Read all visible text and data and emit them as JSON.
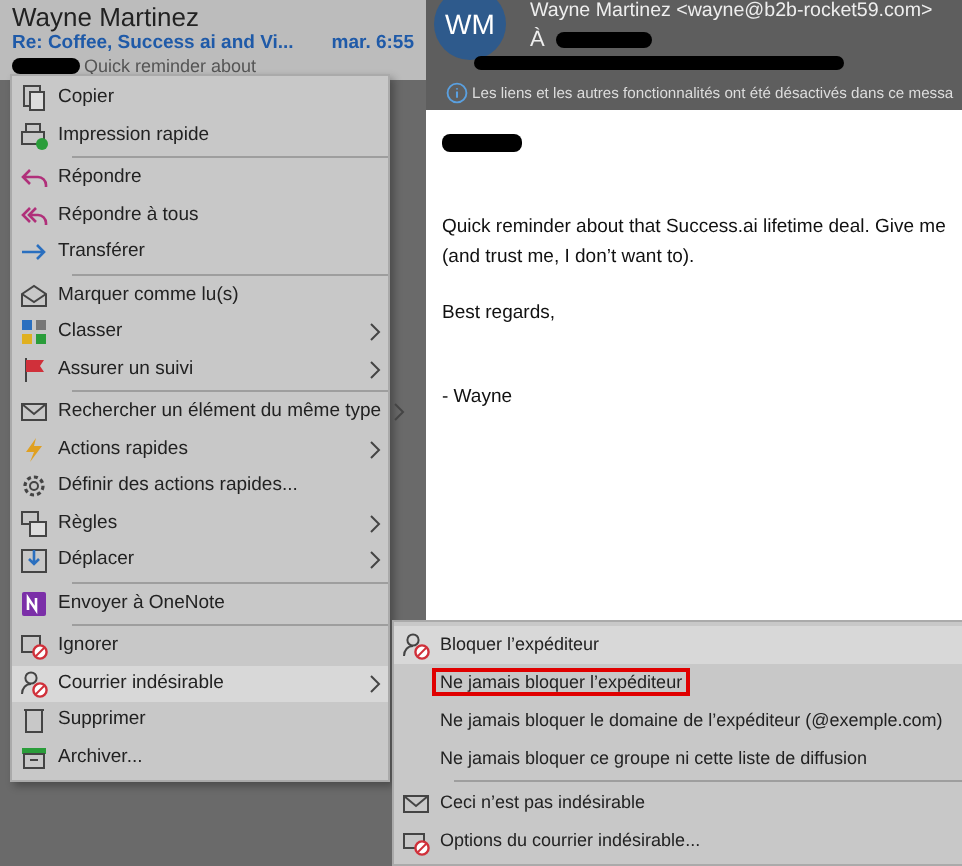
{
  "message_list": {
    "sender": "Wayne Martinez",
    "subject": "Re: Coffee, Success ai and Vi...",
    "date": "mar. 6:55",
    "preview": "Quick reminder about"
  },
  "reading_pane": {
    "avatar_initials": "WM",
    "from": "Wayne Martinez <wayne@b2b-rocket59.com>",
    "to_label": "À",
    "info_bar": "Les liens et les autres fonctionnalités ont été désactivés dans ce messa",
    "body": [
      "Quick reminder about that Success.ai lifetime deal. Give me",
      "(and trust me, I don’t want to).",
      "Best regards,",
      "- Wayne"
    ]
  },
  "context_menu": [
    {
      "kind": "item",
      "label": "Copier",
      "submenu": false,
      "hovered": false
    },
    {
      "kind": "item",
      "label": "Impression rapide",
      "submenu": false,
      "hovered": false
    },
    {
      "kind": "separator"
    },
    {
      "kind": "item",
      "label": "Répondre",
      "submenu": false,
      "hovered": false
    },
    {
      "kind": "item",
      "label": "Répondre à tous",
      "submenu": false,
      "hovered": false
    },
    {
      "kind": "item",
      "label": "Transférer",
      "submenu": false,
      "hovered": false
    },
    {
      "kind": "separator"
    },
    {
      "kind": "item",
      "label": "Marquer comme lu(s)",
      "submenu": false,
      "hovered": false
    },
    {
      "kind": "item",
      "label": "Classer",
      "submenu": true,
      "hovered": false
    },
    {
      "kind": "item",
      "label": "Assurer un suivi",
      "submenu": true,
      "hovered": false
    },
    {
      "kind": "separator"
    },
    {
      "kind": "item",
      "label": "Rechercher un élément du même type",
      "submenu": true,
      "hovered": false
    },
    {
      "kind": "item",
      "label": "Actions rapides",
      "submenu": true,
      "hovered": false
    },
    {
      "kind": "item",
      "label": "Définir des actions rapides...",
      "submenu": false,
      "hovered": false
    },
    {
      "kind": "item",
      "label": "Règles",
      "submenu": true,
      "hovered": false
    },
    {
      "kind": "item",
      "label": "Déplacer",
      "submenu": true,
      "hovered": false
    },
    {
      "kind": "separator"
    },
    {
      "kind": "item",
      "label": "Envoyer à OneNote",
      "submenu": false,
      "hovered": false
    },
    {
      "kind": "separator"
    },
    {
      "kind": "item",
      "label": "Ignorer",
      "submenu": false,
      "hovered": false
    },
    {
      "kind": "item",
      "label": "Courrier indésirable",
      "submenu": true,
      "hovered": true
    },
    {
      "kind": "item",
      "label": "Supprimer",
      "submenu": false,
      "hovered": false
    },
    {
      "kind": "item",
      "label": "Archiver...",
      "submenu": false,
      "hovered": false
    }
  ],
  "junk_submenu": [
    {
      "kind": "item",
      "label": "Bloquer l’expéditeur",
      "hovered": true,
      "outlined": false
    },
    {
      "kind": "item",
      "label": "Ne jamais bloquer l’expéditeur",
      "hovered": false,
      "outlined": true
    },
    {
      "kind": "item",
      "label": "Ne jamais bloquer le domaine de l’expéditeur (@exemple.com)",
      "hovered": false,
      "outlined": false
    },
    {
      "kind": "item",
      "label": "Ne jamais bloquer ce groupe ni cette liste de diffusion",
      "hovered": false,
      "outlined": false
    },
    {
      "kind": "separator"
    },
    {
      "kind": "item",
      "label": "Ceci n’est pas indésirable",
      "hovered": false,
      "outlined": false
    },
    {
      "kind": "item",
      "label": "Options du courrier indésirable...",
      "hovered": false,
      "outlined": false
    }
  ]
}
